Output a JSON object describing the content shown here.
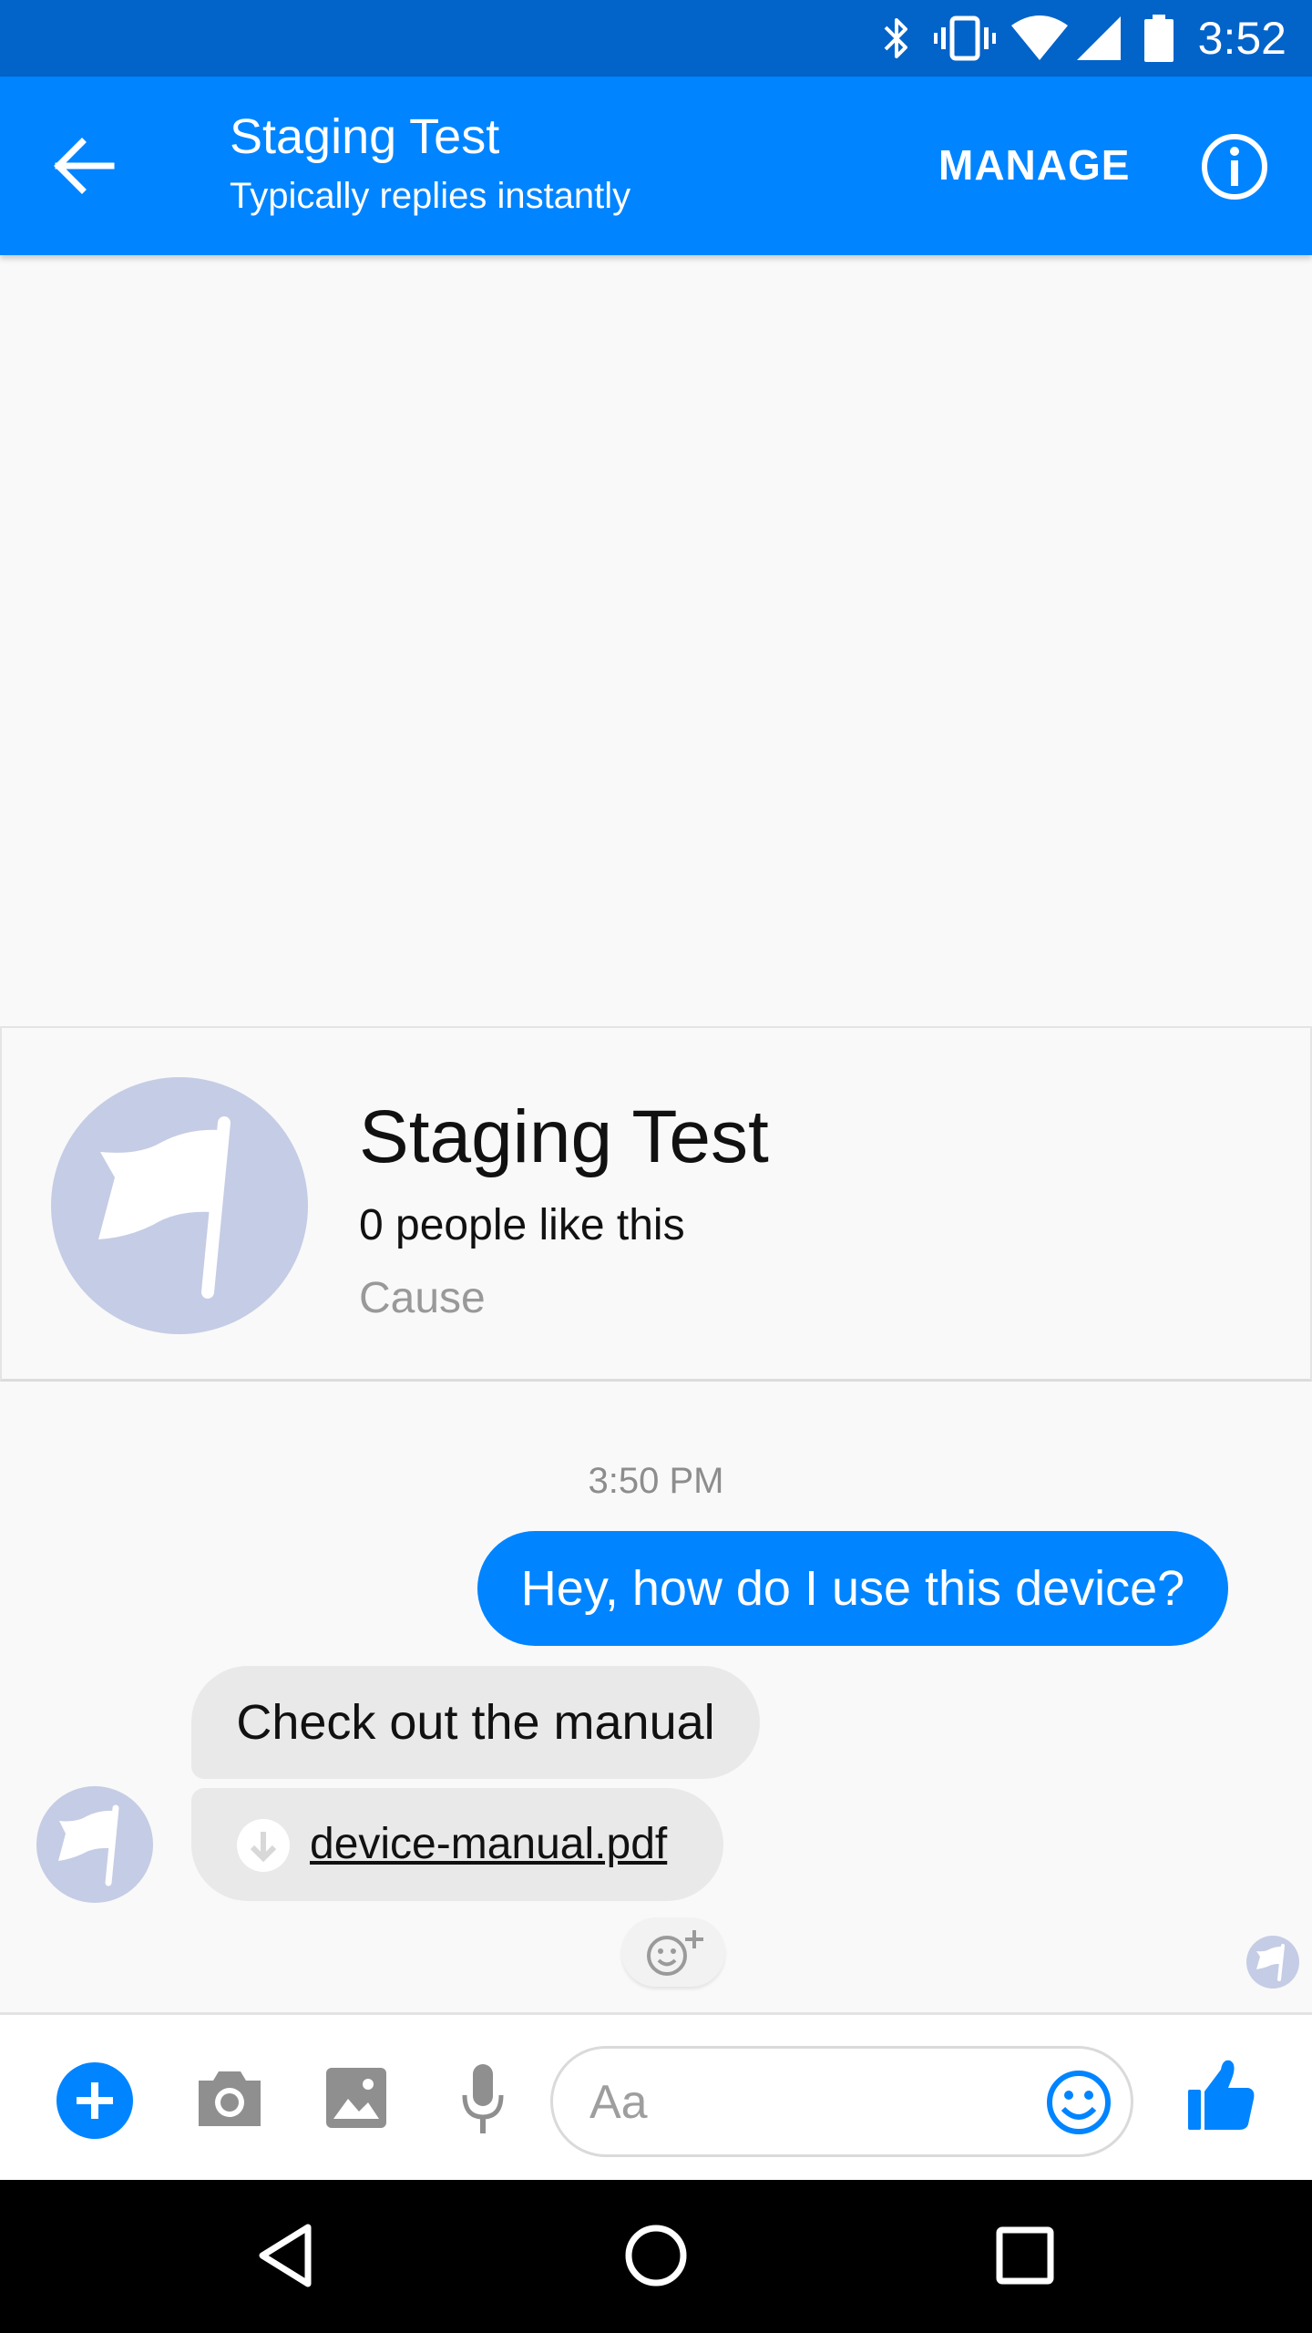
{
  "status_bar": {
    "time": "3:52",
    "icons": [
      "bluetooth-icon",
      "vibrate-icon",
      "wifi-icon",
      "cell-signal-icon",
      "battery-icon"
    ]
  },
  "header": {
    "title": "Staging Test",
    "subtitle": "Typically replies instantly",
    "manage_label": "MANAGE",
    "accent_color": "#0084ff",
    "status_bar_color": "#0263c9"
  },
  "page_card": {
    "name": "Staging Test",
    "likes": "0 people like this",
    "category": "Cause"
  },
  "conversation": {
    "timestamp": "3:50 PM",
    "messages": [
      {
        "direction": "outgoing",
        "text": "Hey, how do I use this device?"
      },
      {
        "direction": "incoming",
        "text": "Check out the manual"
      },
      {
        "direction": "incoming",
        "type": "file",
        "file_name": "device-manual.pdf"
      }
    ]
  },
  "composer": {
    "placeholder": "Aa",
    "buttons": [
      "add-icon",
      "camera-icon",
      "gallery-icon",
      "microphone-icon",
      "emoji-icon",
      "thumbs-up-icon"
    ]
  },
  "nav_bar": {
    "buttons": [
      "back-triangle-icon",
      "home-circle-icon",
      "recents-square-icon"
    ]
  }
}
